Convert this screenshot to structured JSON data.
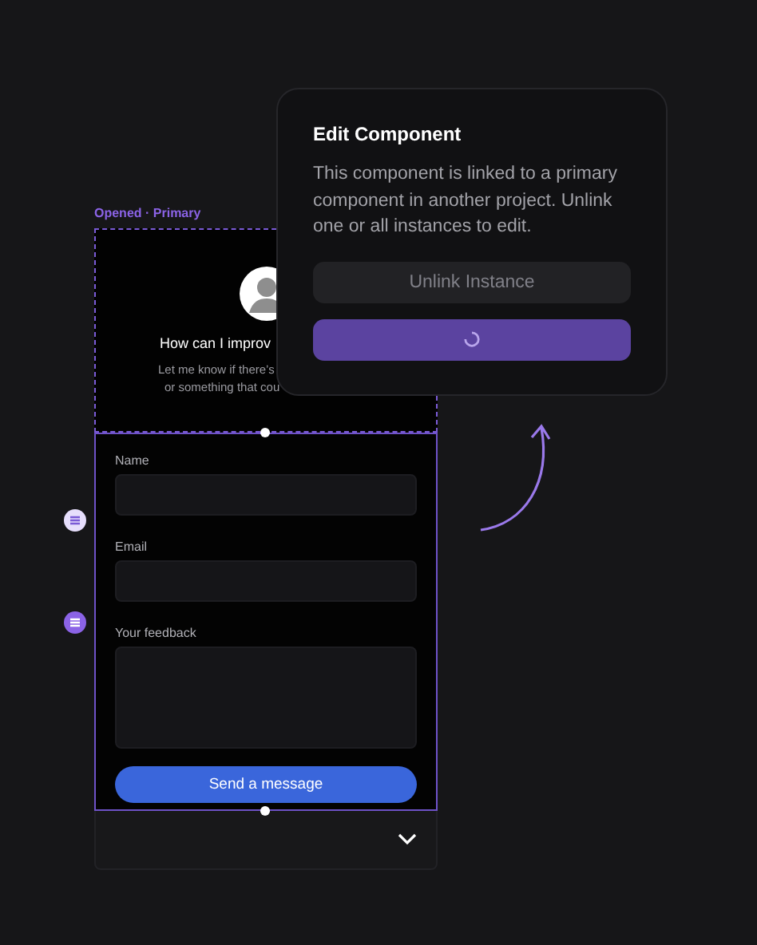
{
  "frame_label": "Opened · Primary",
  "header": {
    "title": "How can I improv",
    "subtitle_lines": [
      "Let me know if there’s",
      "or something that cou"
    ]
  },
  "fields": [
    {
      "label": "Name",
      "kind": "input"
    },
    {
      "label": "Email",
      "kind": "input"
    },
    {
      "label": "Your feedback",
      "kind": "textarea"
    }
  ],
  "submit": "Send a message",
  "popover": {
    "title": "Edit Component",
    "body": "This component is linked to a primary component in another project. Unlink one or all instances to edit.",
    "buttons": [
      {
        "kind": "secondary",
        "label": "Unlink Instance",
        "loading": false
      },
      {
        "kind": "primary",
        "loading": true
      }
    ]
  }
}
